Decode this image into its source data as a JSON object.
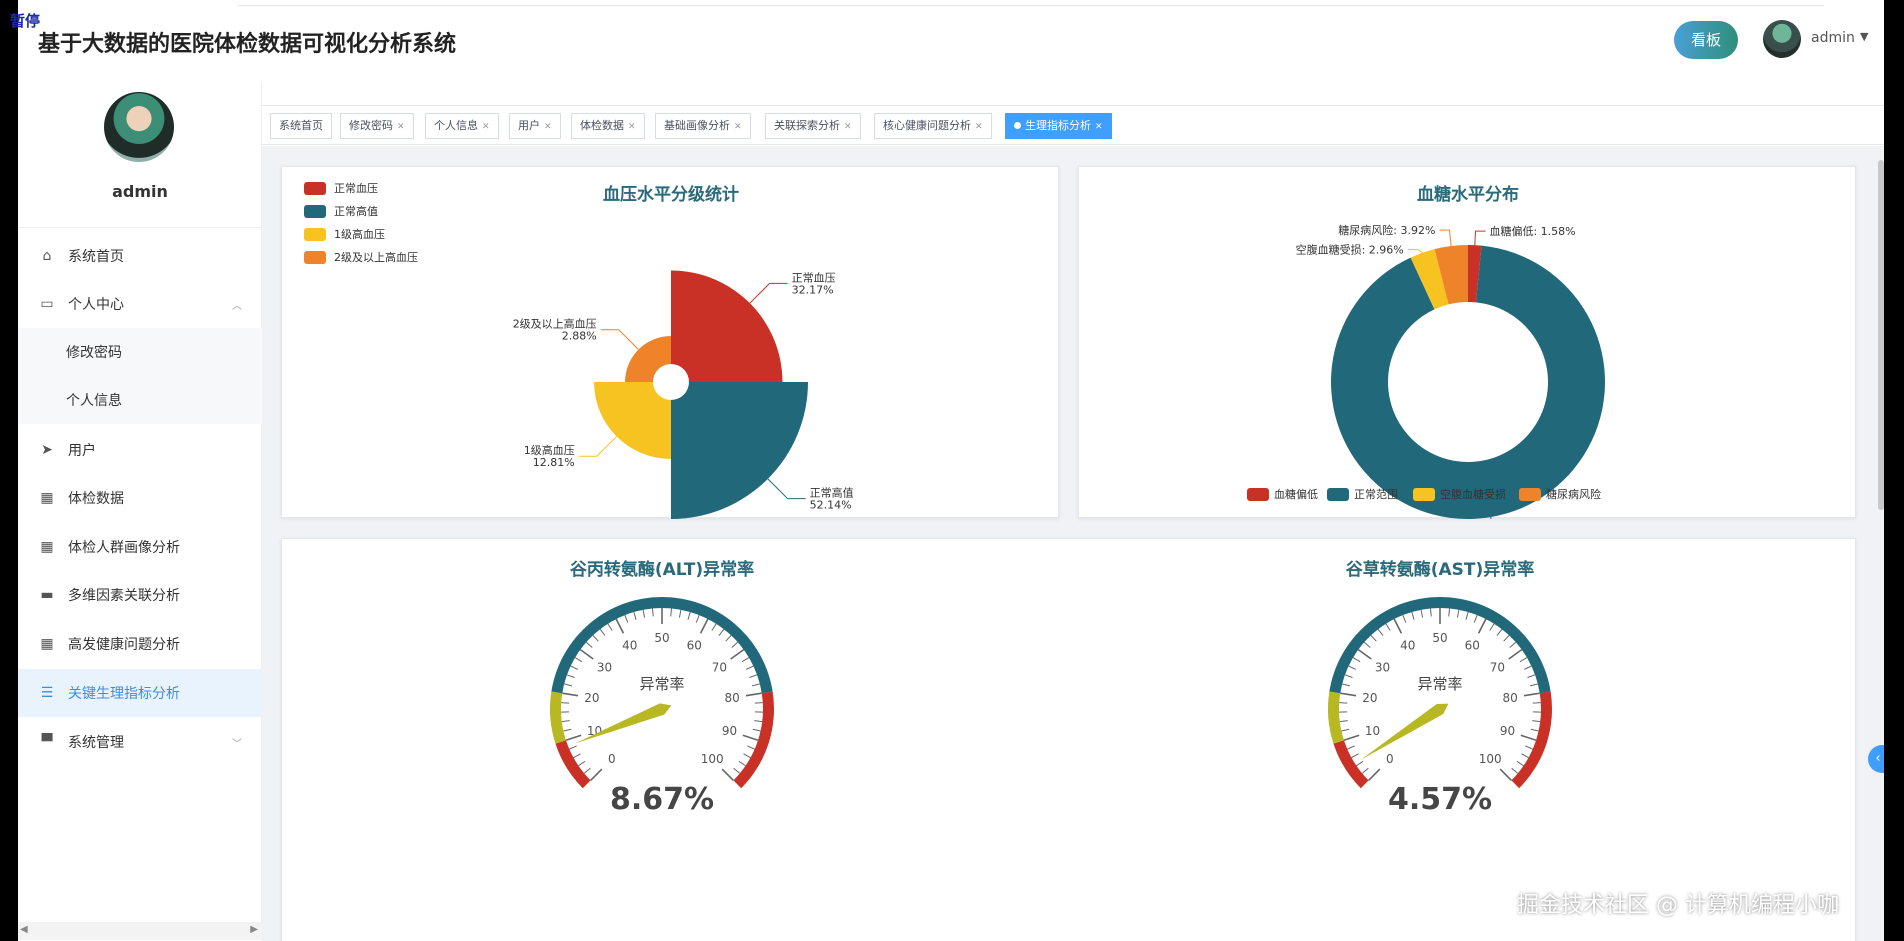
{
  "corner_text": "暂停",
  "header": {
    "title": "基于大数据的医院体检数据可视化分析系统",
    "board_button": "看板",
    "username": "admin"
  },
  "sidebar": {
    "username": "admin",
    "items": [
      {
        "label": "系统首页",
        "icon": "home-icon"
      },
      {
        "label": "个人中心",
        "icon": "card-icon"
      },
      {
        "label": "修改密码"
      },
      {
        "label": "个人信息"
      },
      {
        "label": "用户",
        "icon": "send-icon"
      },
      {
        "label": "体检数据",
        "icon": "grid-icon"
      },
      {
        "label": "体检人群画像分析",
        "icon": "grid-icon"
      },
      {
        "label": "多维因素关联分析",
        "icon": "chat-icon"
      },
      {
        "label": "高发健康问题分析",
        "icon": "grid-icon"
      },
      {
        "label": "关键生理指标分析",
        "icon": "list-icon"
      },
      {
        "label": "系统管理",
        "icon": "printer-icon"
      }
    ]
  },
  "tabs": [
    {
      "label": "系统首页"
    },
    {
      "label": "修改密码"
    },
    {
      "label": "个人信息"
    },
    {
      "label": "用户"
    },
    {
      "label": "体检数据"
    },
    {
      "label": "基础画像分析"
    },
    {
      "label": "关联探索分析"
    },
    {
      "label": "核心健康问题分析"
    },
    {
      "label": "生理指标分析"
    }
  ],
  "colors": {
    "red": "#c93127",
    "teal": "#21687a",
    "yellow": "#f7c321",
    "orange": "#ee8329",
    "olive": "#b8b823",
    "accent": "#409eff"
  },
  "chart_data": [
    {
      "type": "pie",
      "subtype": "rose",
      "title": "血压水平分级统计",
      "legend_position": "top-left",
      "categories": [
        "正常血压",
        "正常高值",
        "1级高血压",
        "2级及以上高血压"
      ],
      "values": [
        32.17,
        52.14,
        12.81,
        2.88
      ],
      "labels": [
        "32.17%",
        "52.14%",
        "12.81%",
        "2.88%"
      ],
      "colors": [
        "#c93127",
        "#21687a",
        "#f7c321",
        "#ee8329"
      ]
    },
    {
      "type": "pie",
      "subtype": "donut",
      "title": "血糖水平分布",
      "legend_position": "bottom",
      "categories": [
        "血糖偏低",
        "正常范围",
        "空腹血糖受损",
        "糖尿病风险"
      ],
      "values": [
        1.58,
        91.54,
        2.96,
        3.92
      ],
      "labels": [
        "血糖偏低: 1.58%",
        "正常范围: 91.54%",
        "空腹血糖受损: 2.96%",
        "糖尿病风险: 3.92%"
      ],
      "colors": [
        "#c93127",
        "#21687a",
        "#f7c321",
        "#ee8329"
      ]
    },
    {
      "type": "gauge",
      "title": "谷丙转氨酶(ALT)异常率",
      "name": "异常率",
      "value": 8.67,
      "value_text": "8.67%",
      "min": 0,
      "max": 100,
      "ticks": [
        "0",
        "10",
        "20",
        "30",
        "40",
        "50",
        "60",
        "70",
        "80",
        "90",
        "100"
      ]
    },
    {
      "type": "gauge",
      "title": "谷草转氨酶(AST)异常率",
      "name": "异常率",
      "value": 4.57,
      "value_text": "4.57%",
      "min": 0,
      "max": 100,
      "ticks": [
        "0",
        "10",
        "20",
        "30",
        "40",
        "50",
        "60",
        "70",
        "80",
        "90",
        "100"
      ]
    }
  ],
  "watermark": "掘金技术社区 @ 计算机编程小咖"
}
